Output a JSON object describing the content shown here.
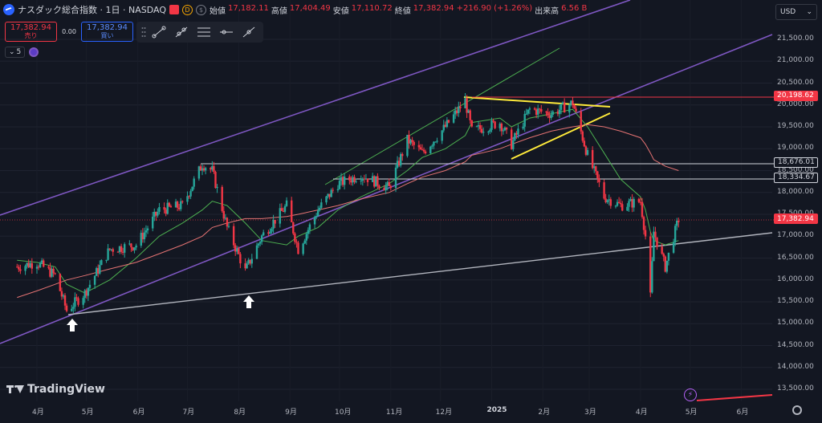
{
  "legend": {
    "title": "ナスダック総合指数 · 1日 · NASDAQ",
    "d_badge": "D",
    "dollar_badge": "$",
    "open_label": "始値",
    "open": "17,182.11",
    "high_label": "高値",
    "high": "17,404.49",
    "low_label": "安値",
    "low": "17,110.72",
    "close_label": "終値",
    "close": "17,382.94",
    "change": "+216.90 (+1.26%)",
    "volume_label": "出来高",
    "volume": "6.56 B"
  },
  "trade": {
    "sell_price": "17,382.94",
    "sell_label": "売り",
    "spread": "0.00",
    "buy_price": "17,382.94",
    "buy_label": "買い"
  },
  "indicators": {
    "collapse_count": "5"
  },
  "currency": {
    "label": "USD"
  },
  "logo": {
    "text": "TradingView"
  },
  "colors": {
    "background": "#131722",
    "up": "#26a69a",
    "down": "#f23645",
    "ma_short": "#4caf50",
    "ma_long": "#e57373",
    "channel": "#7e57c2",
    "support": "#b2b5be",
    "pattern": "#ffeb3b",
    "resistance": "#f23645"
  },
  "chart_data": {
    "type": "candlestick",
    "title": "ナスダック総合指数 · 1日 · NASDAQ",
    "y_axis_labels": [
      "21,500.00",
      "21,000.00",
      "20,500.00",
      "20,000.00",
      "19,500.00",
      "19,000.00",
      "18,500.00",
      "18,000.00",
      "17,500.00",
      "17,000.00",
      "16,500.00",
      "16,000.00",
      "15,500.00",
      "15,000.00",
      "14,500.00",
      "14,000.00",
      "13,500.00"
    ],
    "x_axis_labels": [
      "4月",
      "5月",
      "6月",
      "7月",
      "8月",
      "9月",
      "10月",
      "11月",
      "12月",
      "2025",
      "2月",
      "3月",
      "4月",
      "5月",
      "6月"
    ],
    "ylim": [
      13300,
      22000
    ],
    "price_tags": [
      {
        "value": "20,198.62",
        "style": "red-line"
      },
      {
        "value": "18,676.01",
        "style": "white-line"
      },
      {
        "value": "18,334.67",
        "style": "white-line"
      },
      {
        "value": "17,382.94",
        "style": "current"
      }
    ],
    "series": [
      {
        "name": "close",
        "dates": [
          "2024-03-20",
          "2024-04-01",
          "2024-04-12",
          "2024-04-19",
          "2024-04-30",
          "2024-05-15",
          "2024-05-31",
          "2024-06-14",
          "2024-06-28",
          "2024-07-10",
          "2024-07-16",
          "2024-07-25",
          "2024-08-05",
          "2024-08-15",
          "2024-08-30",
          "2024-09-06",
          "2024-09-18",
          "2024-09-30",
          "2024-10-14",
          "2024-10-31",
          "2024-11-11",
          "2024-11-20",
          "2024-12-04",
          "2024-12-16",
          "2024-12-20",
          "2025-01-06",
          "2025-01-13",
          "2025-01-24",
          "2025-02-06",
          "2025-02-19",
          "2025-02-28",
          "2025-03-10",
          "2025-03-20",
          "2025-04-01",
          "2025-04-04",
          "2025-04-07",
          "2025-04-09",
          "2025-04-16",
          "2025-04-24"
        ],
        "values": [
          16300,
          16400,
          16100,
          15300,
          15700,
          16700,
          16800,
          17600,
          17700,
          18650,
          18500,
          17200,
          16200,
          17000,
          17700,
          16700,
          17600,
          18200,
          18400,
          18100,
          19200,
          18900,
          19500,
          20100,
          19400,
          19600,
          19100,
          19900,
          19800,
          20050,
          18850,
          17900,
          17700,
          17800,
          17000,
          15600,
          17100,
          16300,
          17382.94
        ]
      },
      {
        "name": "high",
        "values": [
          16400,
          16550,
          16350,
          15400,
          15800,
          16800,
          17050,
          17700,
          17950,
          18680,
          18550,
          17400,
          16600,
          17100,
          17800,
          16900,
          17800,
          18300,
          18450,
          18300,
          19300,
          19100,
          19700,
          20150,
          20200,
          20100,
          19500,
          20000,
          19950,
          20150,
          19000,
          18300,
          18000,
          18000,
          17300,
          16200,
          17300,
          16700,
          17404.49
        ]
      },
      {
        "name": "low",
        "values": [
          16200,
          16300,
          16050,
          15200,
          15600,
          16600,
          16700,
          17400,
          17650,
          18400,
          18200,
          17100,
          15700,
          16900,
          17500,
          16650,
          17500,
          18100,
          18300,
          18000,
          19100,
          18800,
          19400,
          19950,
          19300,
          19500,
          19050,
          19800,
          19700,
          19900,
          18600,
          17600,
          17400,
          17500,
          16800,
          14800,
          16100,
          16200,
          17110.72
        ]
      }
    ],
    "moving_averages": [
      {
        "values": [
          16450,
          16400,
          16300,
          15900,
          15700,
          16000,
          16500,
          17000,
          17300,
          17600,
          17800,
          17700,
          17300,
          16900,
          16800,
          17000,
          17200,
          17600,
          17900,
          18200,
          18500,
          18800,
          19000,
          19300,
          19600,
          19700,
          19500,
          19700,
          19800,
          19900,
          19500,
          18900,
          18300,
          17900,
          17600,
          17100,
          16900,
          16800,
          16900
        ]
      },
      {
        "values": [
          15600,
          15750,
          15900,
          16000,
          16100,
          16250,
          16400,
          16600,
          16800,
          17000,
          17200,
          17300,
          17400,
          17400,
          17450,
          17500,
          17600,
          17700,
          17850,
          18000,
          18200,
          18350,
          18500,
          18700,
          18850,
          19000,
          19100,
          19250,
          19400,
          19500,
          19550,
          19500,
          19400,
          19250,
          19100,
          18900,
          18750,
          18600,
          18500
        ]
      }
    ],
    "annotations": [
      "white up arrow near 15,300 (2024-04-19)",
      "white up arrow near 15,700 (2024-08-05)"
    ]
  }
}
